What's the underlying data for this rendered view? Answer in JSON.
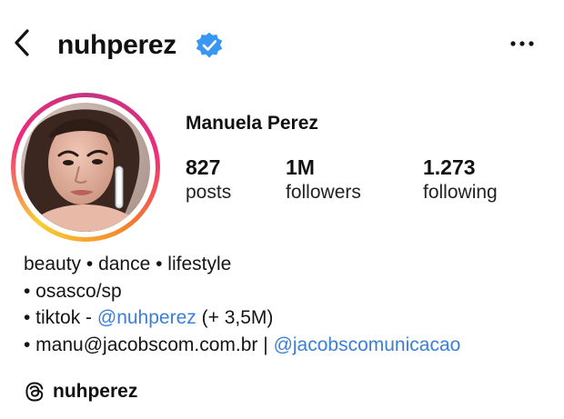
{
  "header": {
    "username": "nuhperez",
    "icons": {
      "back": "chevron-left-icon",
      "verified": "verified-badge-icon",
      "more": "more-options-icon"
    },
    "verified_color": "#3897f0"
  },
  "profile": {
    "display_name": "Manuela Perez",
    "avatar": "profile-photo",
    "ring_colors": [
      "#f9ce34",
      "#ee2a7b",
      "#c13584",
      "#f58529"
    ]
  },
  "stats": [
    {
      "value": "827",
      "label": "posts"
    },
    {
      "value": "1M",
      "label": "followers"
    },
    {
      "value": "1.273",
      "label": "following"
    }
  ],
  "bio": {
    "line1": "beauty • dance • lifestyle",
    "line2": "• osasco/sp",
    "line3_prefix": "• tiktok - ",
    "line3_link": "@nuhperez",
    "line3_suffix": " (+ 3,5M)",
    "line4_prefix": "• manu@jacobscom.com.br | ",
    "line4_link": "@jacobscomunicacao",
    "link_color": "#3b7fd8"
  },
  "threads": {
    "icon": "threads-icon",
    "handle": "nuhperez"
  }
}
